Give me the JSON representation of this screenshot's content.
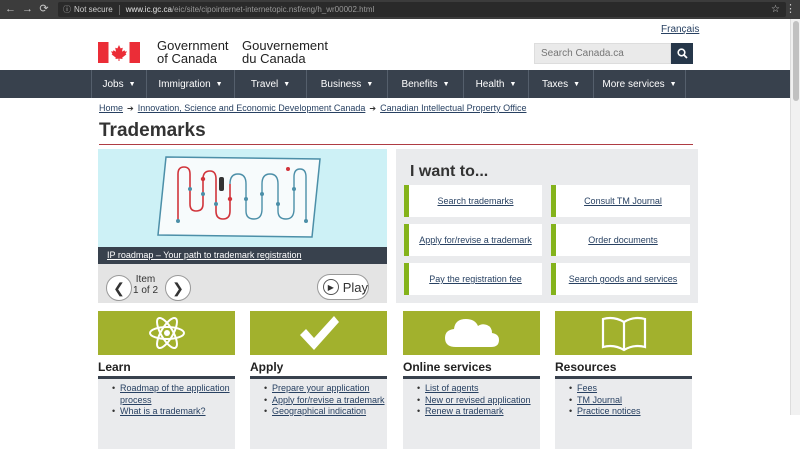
{
  "browser": {
    "security": "Not secure",
    "url_host": "www.ic.gc.ca",
    "url_path": "/eic/site/cipointernet-internetopic.nsf/eng/h_wr00002.html"
  },
  "header": {
    "language_link": "Français",
    "gov_en_line1": "Government",
    "gov_en_line2": "of Canada",
    "gov_fr_line1": "Gouvernement",
    "gov_fr_line2": "du Canada",
    "search_placeholder": "Search Canada.ca"
  },
  "menu": [
    {
      "label": "Jobs"
    },
    {
      "label": "Immigration"
    },
    {
      "label": "Travel"
    },
    {
      "label": "Business"
    },
    {
      "label": "Benefits"
    },
    {
      "label": "Health"
    },
    {
      "label": "Taxes"
    },
    {
      "label": "More services"
    }
  ],
  "breadcrumb": [
    {
      "label": "Home"
    },
    {
      "label": "Innovation, Science and Economic Development Canada"
    },
    {
      "label": "Canadian Intellectual Property Office"
    }
  ],
  "page_title": "Trademarks",
  "carousel": {
    "caption": "IP roadmap – Your path to trademark registration",
    "item_label": "Item",
    "item_position": "1 of 2",
    "play_label": "Play"
  },
  "iwant": {
    "heading": "I want to...",
    "links": [
      "Search trademarks",
      "Consult TM Journal",
      "Apply for/revise a trademark",
      "Order documents",
      "Pay the registration fee",
      "Search goods and services"
    ]
  },
  "cards": [
    {
      "title": "Learn",
      "links": [
        "Roadmap of the application process",
        "What is a trademark?"
      ]
    },
    {
      "title": "Apply",
      "links": [
        "Prepare your application",
        "Apply for/revise a trademark",
        "Geographical indication"
      ]
    },
    {
      "title": "Online services",
      "links": [
        "List of agents",
        "New or revised application",
        "Renew a trademark"
      ]
    },
    {
      "title": "Resources",
      "links": [
        "Fees",
        "TM Journal",
        "Practice notices"
      ]
    }
  ],
  "colors": {
    "accent_green": "#a2b12d",
    "menu_bg": "#38414d",
    "flag_red": "#eb2d37",
    "title_rule": "#af3c43"
  }
}
